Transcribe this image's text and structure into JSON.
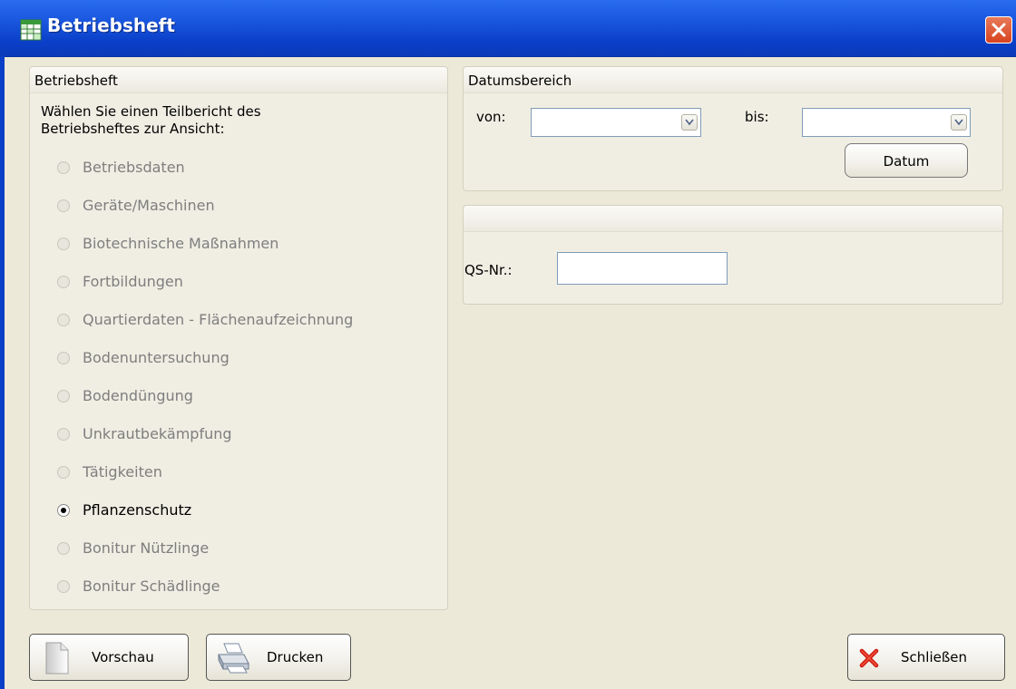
{
  "window": {
    "title": "Betriebsheft"
  },
  "left_group": {
    "title": "Betriebsheft",
    "instruction_line1": "Wählen Sie einen Teilbericht des",
    "instruction_line2": "Betriebsheftes zur Ansicht:",
    "options": [
      {
        "label": "Betriebsdaten",
        "checked": false
      },
      {
        "label": "Geräte/Maschinen",
        "checked": false
      },
      {
        "label": "Biotechnische Maßnahmen",
        "checked": false
      },
      {
        "label": "Fortbildungen",
        "checked": false
      },
      {
        "label": "Quartierdaten - Flächenaufzeichnung",
        "checked": false
      },
      {
        "label": "Bodenuntersuchung",
        "checked": false
      },
      {
        "label": "Bodendüngung",
        "checked": false
      },
      {
        "label": "Unkrautbekämpfung",
        "checked": false
      },
      {
        "label": "Tätigkeiten",
        "checked": false
      },
      {
        "label": "Pflanzenschutz",
        "checked": true
      },
      {
        "label": "Bonitur Nützlinge",
        "checked": false
      },
      {
        "label": "Bonitur Schädlinge",
        "checked": false
      }
    ]
  },
  "date_group": {
    "title": "Datumsbereich",
    "from_label": "von:",
    "from_value": "",
    "to_label": "bis:",
    "to_value": "",
    "date_button": "Datum"
  },
  "qs_group": {
    "title": "",
    "qs_label": "QS-Nr.:",
    "qs_value": ""
  },
  "buttons": {
    "preview": "Vorschau",
    "print": "Drucken",
    "close": "Schließen"
  }
}
